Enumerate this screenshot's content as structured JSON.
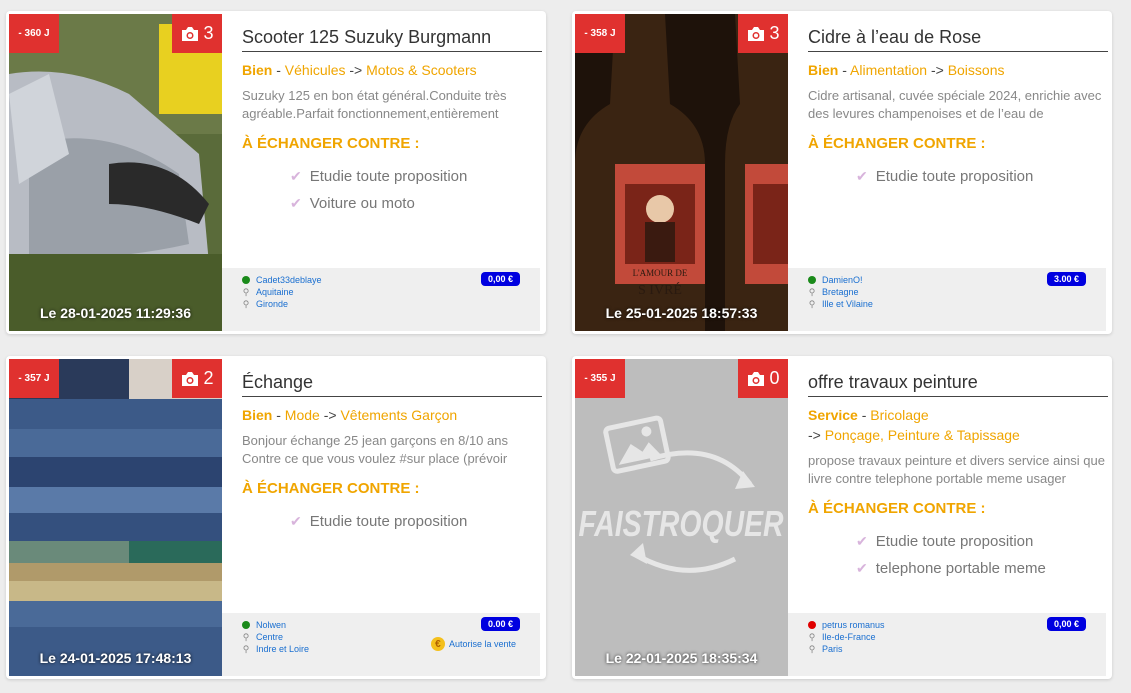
{
  "listings": [
    {
      "age": "- 360 J",
      "photo_count": "3",
      "date": "Le 28-01-2025 11:29:36",
      "title": "Scooter 125 Suzuky Burgmann",
      "type": "Bien",
      "category": "Véhicules",
      "subcategory": "Motos & Scooters",
      "description": "Suzuky 125 en bon état général.Conduite très agréable.Parfait fonctionnement,entièrement",
      "exchange_heading": "À ÉCHANGER CONTRE :",
      "wants": [
        "Etudie toute proposition",
        "Voiture ou moto"
      ],
      "seller": "Cadet33deblaye",
      "region": "Aquitaine",
      "department": "Gironde",
      "price": "0,00 €",
      "status_color": "#1a8a1a"
    },
    {
      "age": "- 358 J",
      "photo_count": "3",
      "date": "Le 25-01-2025 18:57:33",
      "title": "Cidre à l’eau de Rose",
      "type": "Bien",
      "category": "Alimentation",
      "subcategory": "Boissons",
      "description": "Cidre artisanal, cuvée spéciale 2024, enrichie avec des levures champenoises et de l’eau de",
      "exchange_heading": "À ÉCHANGER CONTRE :",
      "wants": [
        "Etudie toute proposition"
      ],
      "seller": "DamienO!",
      "region": "Bretagne",
      "department": "Ille et Vilaine",
      "price": "3.00 €",
      "status_color": "#1a8a1a"
    },
    {
      "age": "- 357 J",
      "photo_count": "2",
      "date": "Le 24-01-2025 17:48:13",
      "title": "Échange",
      "type": "Bien",
      "category": "Mode",
      "subcategory": "Vêtements Garçon",
      "description": "Bonjour échange 25 jean garçons en 8/10 ans Contre ce que vous voulez #sur place (prévoir",
      "exchange_heading": "À ÉCHANGER CONTRE :",
      "wants": [
        "Etudie toute proposition"
      ],
      "seller": "Nolwen",
      "region": "Centre",
      "department": "Indre et Loire",
      "price": "0.00 €",
      "sale_label": "Autorise la vente",
      "status_color": "#1a8a1a"
    },
    {
      "age": "- 355 J",
      "photo_count": "0",
      "date": "Le 22-01-2025 18:35:34",
      "title": "offre travaux peinture",
      "type": "Service",
      "category": "Bricolage",
      "subcategory": "Ponçage, Peinture & Tapissage",
      "description": "propose travaux peinture et divers service ainsi que livre contre telephone portable meme usager",
      "exchange_heading": "À ÉCHANGER CONTRE :",
      "wants": [
        "Etudie toute proposition",
        "telephone portable meme"
      ],
      "seller": "petrus romanus",
      "region": "Ile-de-France",
      "department": "Paris",
      "price": "0,00 €",
      "status_color": "#e00000",
      "placeholder_logo_text": "FAISTROQUER"
    }
  ],
  "colors": {
    "badge": "#e0312f",
    "accent": "#f0a500",
    "price_bg": "#0000e0",
    "link": "#1a6fd0"
  },
  "icons": {
    "camera": "camera-icon",
    "check": "check-icon",
    "pin": "location-pin-icon",
    "sale": "sale-icon"
  }
}
